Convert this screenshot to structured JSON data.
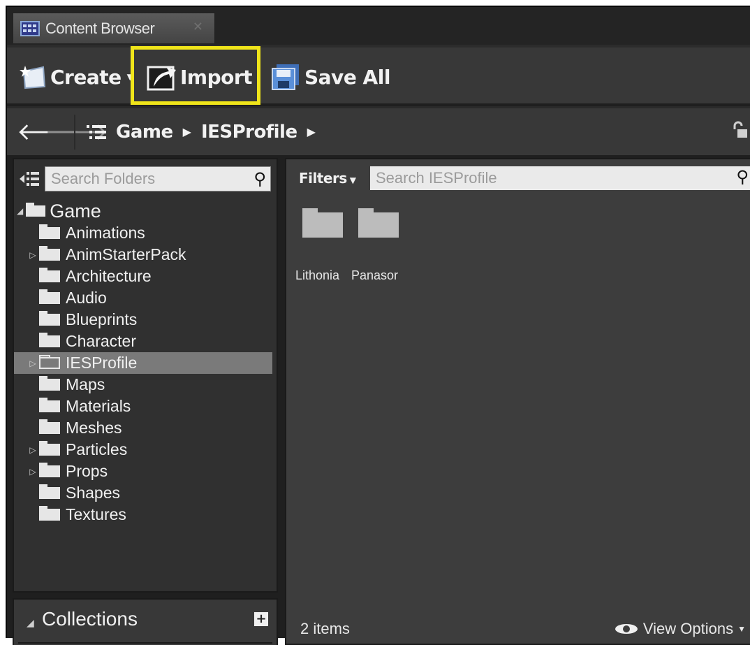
{
  "window": {
    "tab_title": "Content Browser",
    "tab_close": "✕"
  },
  "toolbar": {
    "create_label": "Create",
    "import_label": "Import",
    "save_all_label": "Save All",
    "highlight_color": "#f0e51a"
  },
  "navigation": {
    "back": "🡐",
    "forward": "🡒",
    "breadcrumb": [
      "Game",
      "IESProfile"
    ],
    "lock_icon": "lock-icon"
  },
  "folders_panel": {
    "search_placeholder": "Search Folders",
    "root": "Game",
    "items": [
      {
        "label": "Animations",
        "expandable": false,
        "selected": false
      },
      {
        "label": "AnimStarterPack",
        "expandable": true,
        "selected": false
      },
      {
        "label": "Architecture",
        "expandable": false,
        "selected": false
      },
      {
        "label": "Audio",
        "expandable": false,
        "selected": false
      },
      {
        "label": "Blueprints",
        "expandable": false,
        "selected": false
      },
      {
        "label": "Character",
        "expandable": false,
        "selected": false
      },
      {
        "label": "IESProfile",
        "expandable": true,
        "selected": true
      },
      {
        "label": "Maps",
        "expandable": false,
        "selected": false
      },
      {
        "label": "Materials",
        "expandable": false,
        "selected": false
      },
      {
        "label": "Meshes",
        "expandable": false,
        "selected": false
      },
      {
        "label": "Particles",
        "expandable": true,
        "selected": false
      },
      {
        "label": "Props",
        "expandable": true,
        "selected": false
      },
      {
        "label": "Shapes",
        "expandable": false,
        "selected": false
      },
      {
        "label": "Textures",
        "expandable": false,
        "selected": false
      }
    ]
  },
  "collections": {
    "label": "Collections"
  },
  "asset_panel": {
    "filters_label": "Filters",
    "search_placeholder": "Search IESProfile",
    "assets": [
      {
        "label": "Lithonia"
      },
      {
        "label": "Panasor"
      }
    ],
    "status": "2 items",
    "view_options": "View Options"
  }
}
